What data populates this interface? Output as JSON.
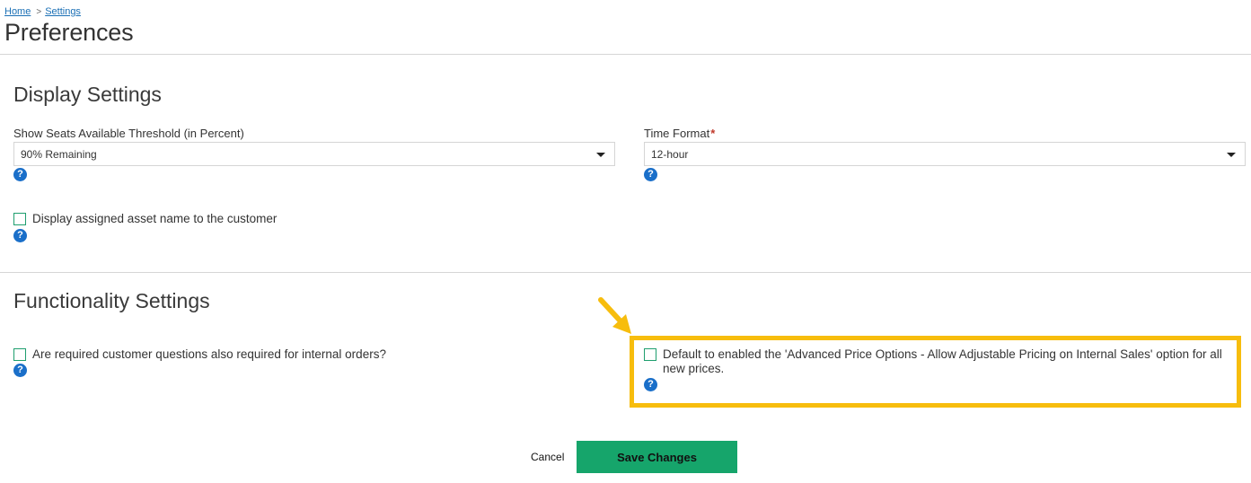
{
  "breadcrumb": {
    "home": "Home",
    "separator": ">",
    "settings": "Settings"
  },
  "page": {
    "title": "Preferences"
  },
  "display_settings": {
    "title": "Display Settings",
    "seats_threshold": {
      "label": "Show Seats Available Threshold (in Percent)",
      "value": "90% Remaining"
    },
    "time_format": {
      "label": "Time Format",
      "required": "*",
      "value": "12-hour"
    },
    "asset_name": {
      "label": "Display assigned asset name to the customer",
      "checked": false
    }
  },
  "functionality_settings": {
    "title": "Functionality Settings",
    "required_questions": {
      "label": "Are required customer questions also required for internal orders?",
      "checked": false
    },
    "advanced_price": {
      "label": "Default to enabled the 'Advanced Price Options - Allow Adjustable Pricing on Internal Sales' option for all new prices.",
      "checked": false
    }
  },
  "help_icon": {
    "glyph": "?"
  },
  "actions": {
    "cancel": "Cancel",
    "save": "Save Changes"
  },
  "colors": {
    "accent_green": "#16a56b",
    "highlight": "#f7bd0d",
    "link": "#1a6fb5",
    "help": "#1a6fc9"
  }
}
